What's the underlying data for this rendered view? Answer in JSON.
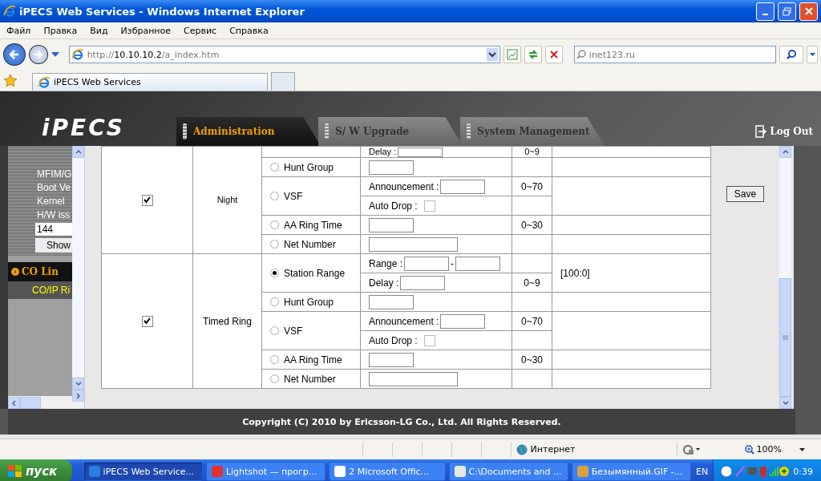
{
  "window": {
    "title": "iPECS Web Services - Windows Internet Explorer"
  },
  "menu": [
    "Файл",
    "Правка",
    "Вид",
    "Избранное",
    "Сервис",
    "Справка"
  ],
  "address": {
    "value": "http://**10.10.10.2**/a_index.htm"
  },
  "search": {
    "placeholder": "inet123.ru"
  },
  "browser_tab": {
    "label": "iPECS Web Services"
  },
  "app": {
    "logo": "iPECS",
    "logout": "Log Out",
    "tabs": [
      {
        "label": "Administration",
        "selected": true
      },
      {
        "label": "S/ W Upgrade",
        "selected": false
      },
      {
        "label": "System Management",
        "selected": false
      }
    ]
  },
  "sidebar": {
    "info": [
      "MFIM/G",
      "Boot Ve",
      "Kernel",
      "H/W iss"
    ],
    "field_value": "144",
    "show_button": "Show",
    "section": "CO Lin",
    "item": "CO/IP Ri"
  },
  "groups": [
    {
      "enabled": true,
      "name": "Night",
      "options": [
        {
          "kind": "continued",
          "fields": [
            {
              "kind": "labeled_input",
              "label": "Delay :",
              "range": "0~9"
            }
          ]
        },
        {
          "kind": "radio",
          "label": "Hunt Group",
          "selected": false,
          "fields": [
            {
              "kind": "input"
            }
          ]
        },
        {
          "kind": "radio",
          "label": "VSF",
          "selected": false,
          "fields": [
            {
              "kind": "labeled_input",
              "label": "Announcement :",
              "range": "0~70"
            },
            {
              "kind": "checkbox",
              "label": "Auto Drop :",
              "checked": false
            }
          ]
        },
        {
          "kind": "radio",
          "label": "AA Ring Time",
          "selected": false,
          "fields": [
            {
              "kind": "input",
              "range": "0~30"
            }
          ]
        },
        {
          "kind": "radio",
          "label": "Net Number",
          "selected": false,
          "fields": [
            {
              "kind": "wide_input"
            }
          ]
        }
      ]
    },
    {
      "enabled": true,
      "name": "Timed Ring",
      "options": [
        {
          "kind": "radio",
          "label": "Station Range",
          "selected": true,
          "value": "[100:0]",
          "fields": [
            {
              "kind": "range_pair",
              "label": "Range :",
              "separator": "-"
            },
            {
              "kind": "labeled_input",
              "label": "Delay :",
              "range": "0~9"
            }
          ]
        },
        {
          "kind": "radio",
          "label": "Hunt Group",
          "selected": false,
          "fields": [
            {
              "kind": "input"
            }
          ]
        },
        {
          "kind": "radio",
          "label": "VSF",
          "selected": false,
          "fields": [
            {
              "kind": "labeled_input",
              "label": "Announcement :",
              "range": "0~70"
            },
            {
              "kind": "checkbox",
              "label": "Auto Drop :",
              "checked": false
            }
          ]
        },
        {
          "kind": "radio",
          "label": "AA Ring Time",
          "selected": false,
          "fields": [
            {
              "kind": "input",
              "range": "0~30"
            }
          ]
        },
        {
          "kind": "radio",
          "label": "Net Number",
          "selected": false,
          "fields": [
            {
              "kind": "wide_input"
            }
          ]
        }
      ]
    }
  ],
  "save_button": "Save",
  "copyright": "Copyright (C) 2010 by Ericsson-LG Co., Ltd. All Rights Reserved.",
  "status_bar": {
    "zone": "Интернет",
    "zoom": "100%"
  },
  "taskbar": {
    "start": "пуск",
    "items": [
      {
        "label": "iPECS Web Service...",
        "selected": true
      },
      {
        "label": "Lightshot — прогр...",
        "selected": false
      },
      {
        "label": "2 Microsoft Offic...",
        "selected": false
      },
      {
        "label": "C:\\Documents and ...",
        "selected": false
      },
      {
        "label": "Безымянный.GIF -...",
        "selected": false
      }
    ],
    "language": "EN",
    "clock": "0:39"
  }
}
